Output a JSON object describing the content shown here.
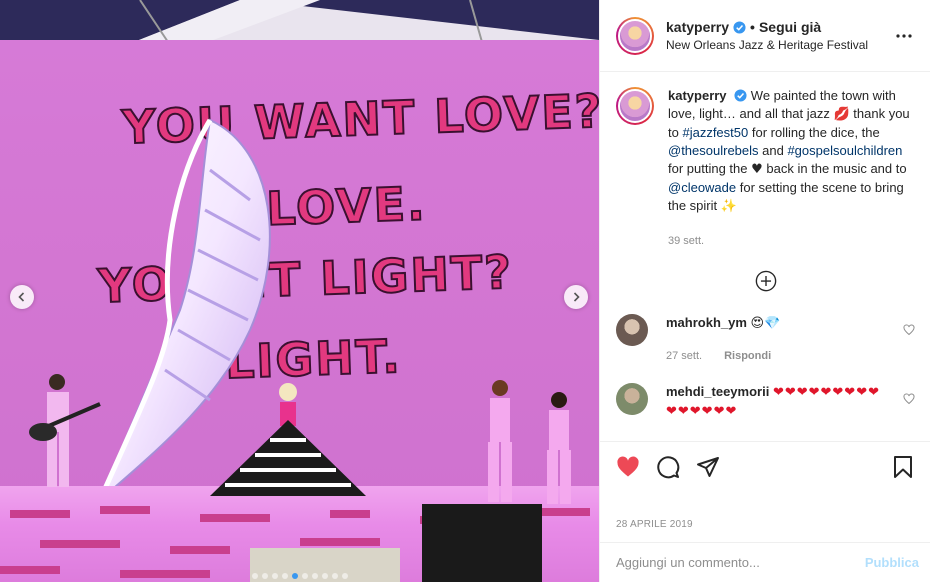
{
  "media": {
    "slogan_line1": "YOU WANT LOVE?",
    "slogan_line2": "E LOVE.",
    "slogan_line3": "YO    ANT LIGHT?",
    "slogan_line4": "LIGHT.",
    "carousel_total": 10,
    "carousel_active": 4
  },
  "header": {
    "username": "katyperry",
    "separator": "•",
    "follow_label": "Segui già",
    "location": "New Orleans Jazz & Heritage Festival"
  },
  "caption": {
    "username": "katyperry",
    "text_1": " We painted the town with love, light… and all that jazz ",
    "emoji_1": "💋",
    "text_2": " thank you to ",
    "tag_1": "#jazzfest50",
    "text_3": " for rolling the dice, the ",
    "tag_2": "@thesoulrebels",
    "text_4": " and ",
    "tag_3": "#gospelsoulchildren",
    "text_5": " for putting the ",
    "emoji_2": "♥",
    "text_6": " back in the music and to ",
    "tag_4": "@cleowade",
    "text_7": " for setting the scene to bring the spirit ",
    "emoji_3": "✨",
    "time": "39 sett."
  },
  "comments": [
    {
      "username": "mahrokh_ym",
      "text": "😍💎",
      "time": "27 sett.",
      "reply_label": "Rispondi"
    },
    {
      "username": "mehdi_teeymorii",
      "text": "❤❤❤❤❤❤❤❤❤❤❤❤❤❤❤"
    }
  ],
  "footer": {
    "date": "28 APRILE 2019",
    "comment_placeholder": "Aggiungi un commento...",
    "publish_label": "Pubblica"
  },
  "colors": {
    "like_red": "#ed4956",
    "link_blue": "#003569",
    "verified_blue": "#3897f0",
    "publish_disabled": "#b2dffc"
  },
  "icons": [
    "verified-icon",
    "more-options-icon",
    "plus-circle-icon",
    "heart-icon",
    "comment-icon",
    "share-icon",
    "bookmark-icon",
    "chevron-left-icon",
    "chevron-right-icon"
  ]
}
